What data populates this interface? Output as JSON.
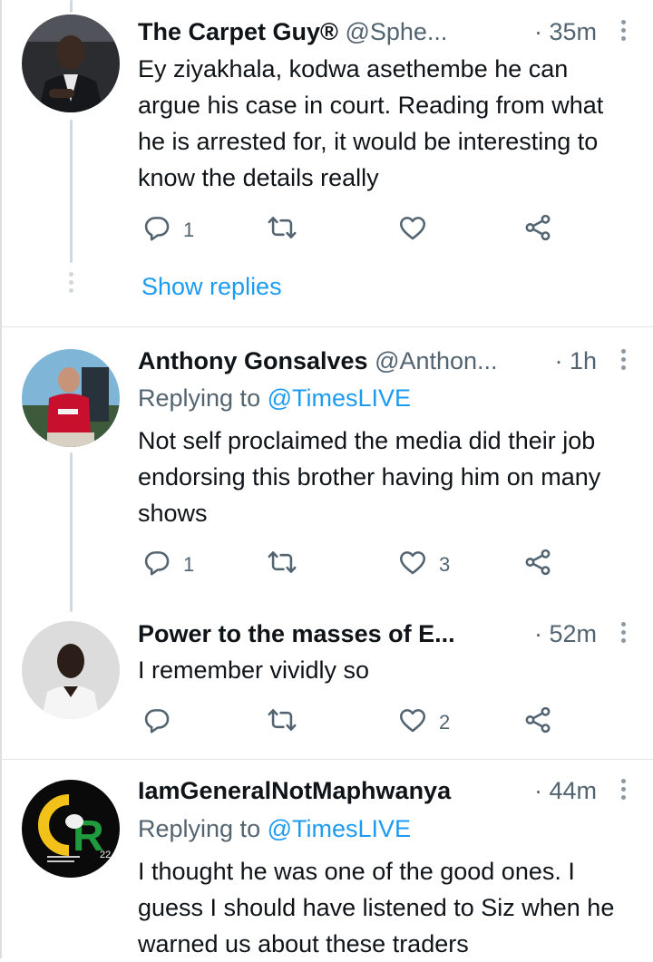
{
  "tweets": [
    {
      "name": "The Carpet Guy®",
      "handle": "@Sphe...",
      "time": "· 35m",
      "replying_to_label": "",
      "replying_to_handle": "",
      "text": "Ey ziyakhala, kodwa asethembe he can argue his case in court. Reading from what he is arrested for, it would be interesting to know the details really",
      "reply_count": "1",
      "retweet_count": "",
      "like_count": ""
    },
    {
      "name": "Anthony Gonsalves",
      "handle": "@Anthon...",
      "time": "· 1h",
      "replying_to_label": "Replying to",
      "replying_to_handle": "@TimesLIVE",
      "text": "Not self proclaimed the media did their job endorsing this brother having him on many shows",
      "reply_count": "1",
      "retweet_count": "",
      "like_count": "3"
    },
    {
      "name": "Power to the masses of E...",
      "handle": "",
      "time": "· 52m",
      "replying_to_label": "",
      "replying_to_handle": "",
      "text": "I remember vividly so",
      "reply_count": "",
      "retweet_count": "",
      "like_count": "2"
    },
    {
      "name": "IamGeneralNotMaphwanya",
      "handle": "",
      "time": "· 44m",
      "replying_to_label": "Replying to",
      "replying_to_handle": "@TimesLIVE",
      "text": "I thought he was one of the good ones. I guess I should have listened to Siz when he warned us about these traders",
      "avatar_logo_text": "R",
      "avatar_logo_number": "22"
    }
  ],
  "show_replies_label": "Show replies",
  "colors": {
    "link": "#1d9bf0",
    "secondary_text": "#536471",
    "primary_text": "#0f1419",
    "thread_line": "#cfd9de"
  },
  "icons": {
    "reply": "reply-icon",
    "retweet": "retweet-icon",
    "like": "heart-icon",
    "share": "share-icon",
    "more": "more-options-icon"
  }
}
